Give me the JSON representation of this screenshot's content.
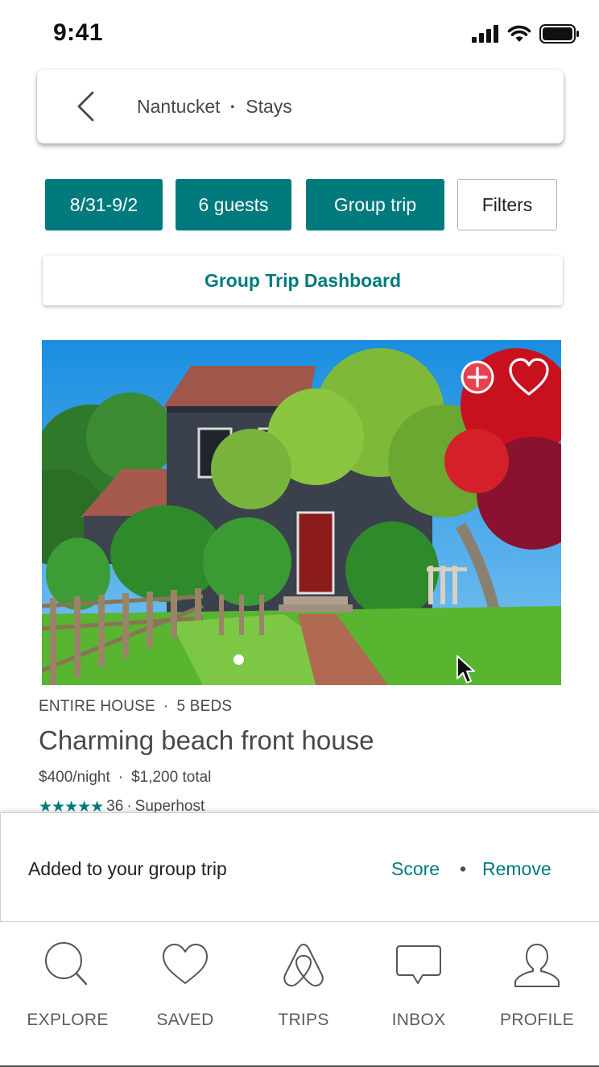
{
  "status_bar": {
    "time": "9:41"
  },
  "search": {
    "location": "Nantucket",
    "category": "Stays"
  },
  "filters": {
    "dates": "8/31-9/2",
    "guests": "6 guests",
    "group": "Group trip",
    "more": "Filters"
  },
  "dashboard": {
    "label": "Group Trip Dashboard"
  },
  "listing": {
    "type": "ENTIRE HOUSE",
    "beds": "5 BEDS",
    "title": "Charming beach front house",
    "price_night": "$400/night",
    "price_total": "$1,200 total",
    "stars": "★★★★★",
    "reviews": "36",
    "separator": "·",
    "badge": "Superhost",
    "photo_index": 1
  },
  "toast": {
    "message": "Added to your group trip",
    "score": "Score",
    "separator": "•",
    "remove": "Remove"
  },
  "tabs": [
    {
      "label": "EXPLORE",
      "icon": "search-icon"
    },
    {
      "label": "SAVED",
      "icon": "heart-icon"
    },
    {
      "label": "TRIPS",
      "icon": "airbnb-logo-icon"
    },
    {
      "label": "INBOX",
      "icon": "chat-bubble-icon"
    },
    {
      "label": "PROFILE",
      "icon": "person-icon"
    }
  ],
  "colors": {
    "accent": "#007a7d",
    "text": "#484848",
    "add_button": "#e8424f"
  }
}
